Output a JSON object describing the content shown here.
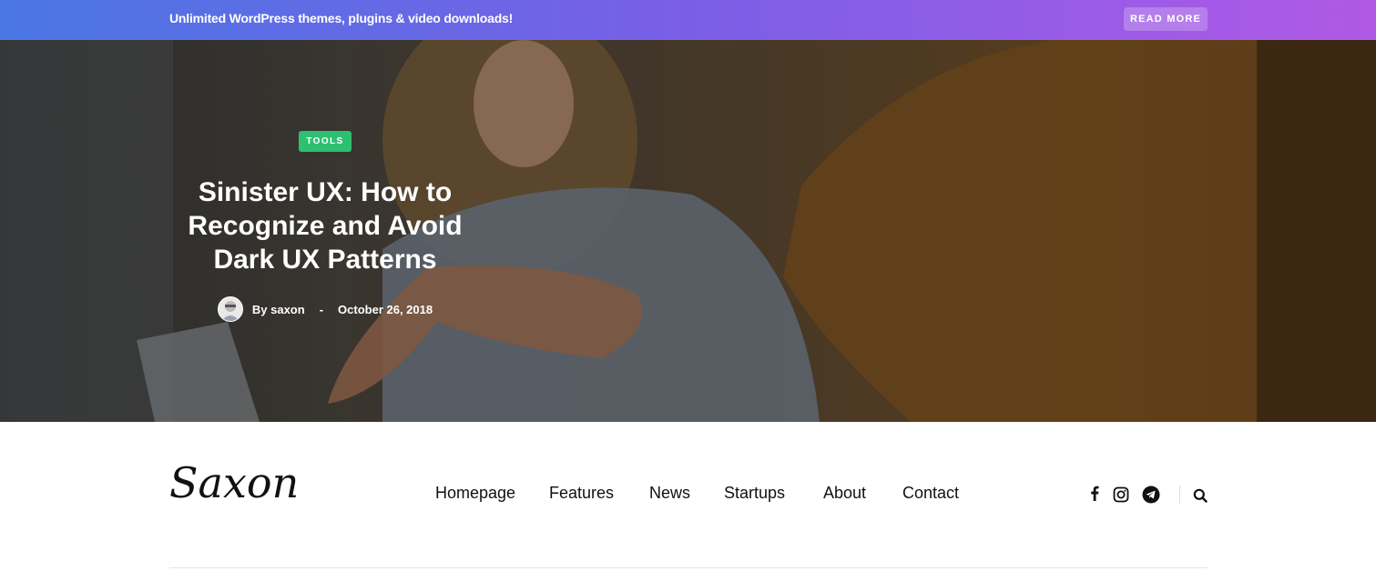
{
  "topbar": {
    "text": "Unlimited WordPress themes, plugins & video downloads!",
    "button_label": "READ MORE"
  },
  "hero": {
    "tag": "TOOLS",
    "title": "Sinister UX: How to Recognize and Avoid Dark UX Patterns",
    "author": "By saxon",
    "separator": "-",
    "date": "October 26, 2018"
  },
  "header": {
    "logo": "Saxon",
    "nav": [
      "Homepage",
      "Features",
      "News",
      "Startups",
      "About",
      "Contact"
    ],
    "icons": [
      "facebook-icon",
      "instagram-icon",
      "telegram-icon",
      "search-icon"
    ]
  },
  "colors": {
    "tag_green": "#2fbf71",
    "gradient_start": "#4a76e4",
    "gradient_end": "#b059e6"
  }
}
